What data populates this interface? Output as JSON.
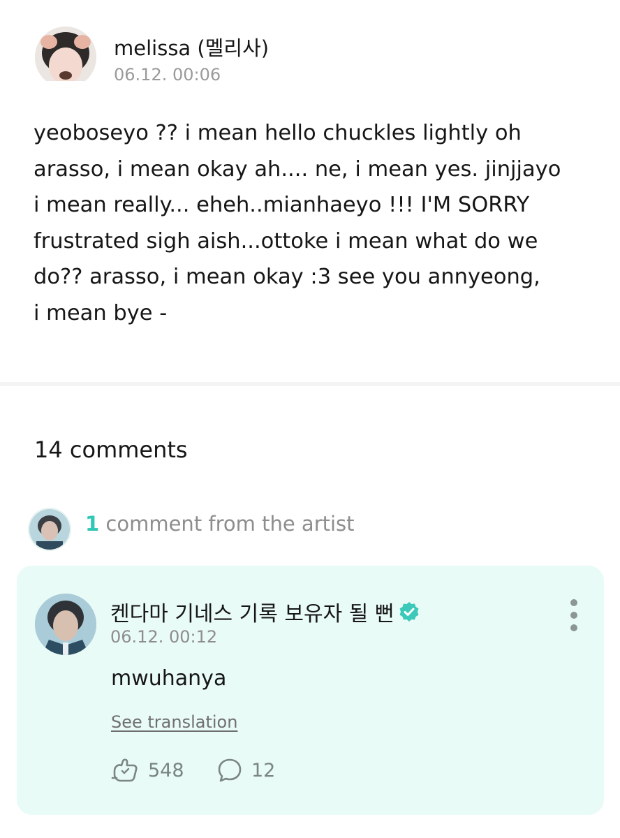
{
  "post": {
    "author": "melissa (멜리사)",
    "timestamp": "06.12. 00:06",
    "body_lines": [
      "yeoboseyo ?? i mean hello chuckles lightly oh",
      "arasso, i mean okay ah.... ne, i mean yes. jinjjayo",
      "i mean really... eheh..mianhaeyo !!! I'M SORRY",
      "frustrated sigh aish...ottoke i mean what do we",
      "do?? arasso, i mean okay :3 see you annyeong,",
      "i mean bye -"
    ]
  },
  "comments": {
    "count_label": "14 comments",
    "artist_count": "1",
    "artist_label": "comment from the artist"
  },
  "artist_comment": {
    "author": "켄다마 기네스 기록 보유자 될 뻔",
    "timestamp": "06.12. 00:12",
    "text": "mwuhanya",
    "see_translation": "See translation",
    "likes": "548",
    "replies": "12",
    "verified_icon": "verified-badge-icon"
  },
  "colors": {
    "accent": "#2fc7b5",
    "card_background": "#e9fbf7",
    "muted_text": "#9a9a9a"
  }
}
